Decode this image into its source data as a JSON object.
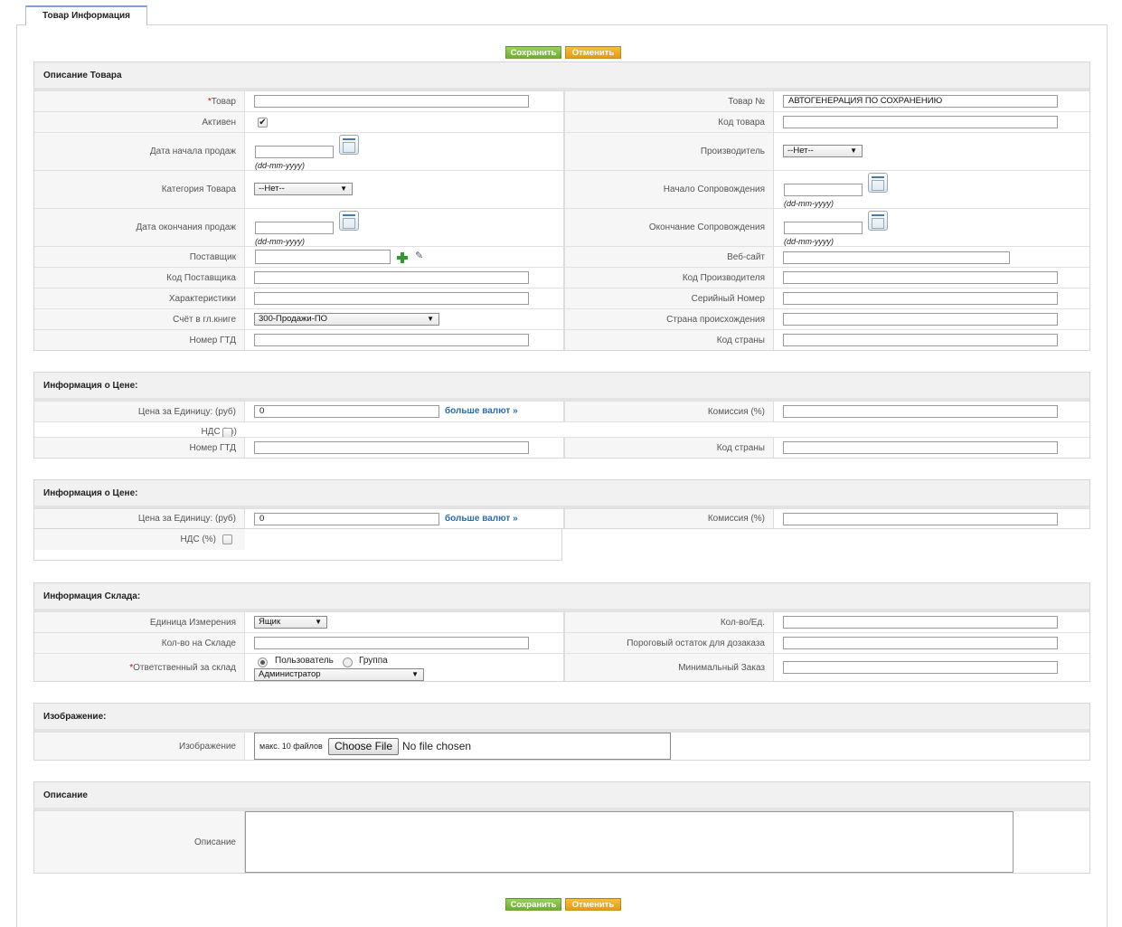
{
  "tab": {
    "label": "Товар Информация"
  },
  "buttons": {
    "save": "Сохранить",
    "cancel": "Отменить"
  },
  "sections": {
    "product": "Описание Товара",
    "price1": "Информация о Цене:",
    "price2": "Информация о Цене:",
    "stock": "Информация Склада:",
    "image": "Изображение:",
    "description": "Описание"
  },
  "product": {
    "tovar_label": "Товар",
    "tovar_no_label": "Товар №",
    "tovar_no_value": "АВТОГЕНЕРАЦИЯ ПО СОХРАНЕНИЮ",
    "active_label": "Активен",
    "active_checked": "✔",
    "code_label": "Код товара",
    "sales_start_label": "Дата начала продаж",
    "manufacturer_label": "Производитель",
    "manufacturer_value": "--Нет--",
    "category_label": "Категория Товара",
    "category_value": "--Нет--",
    "support_start_label": "Начало Сопровождения",
    "sales_end_label": "Дата окончания продаж",
    "support_end_label": "Окончание Сопровождения",
    "date_hint": "(dd-mm-yyyy)",
    "vendor_label": "Поставщик",
    "website_label": "Веб-сайт",
    "vendor_code_label": "Код Поставщика",
    "mfr_code_label": "Код Производителя",
    "specs_label": "Характеристики",
    "serial_label": "Серийный Номер",
    "gl_label": "Счёт в гл.книге",
    "gl_value": "300-Продажи-ПО",
    "origin_label": "Страна происхождения",
    "gtd_label": "Номер ГТД",
    "country_code_label": "Код страны"
  },
  "price1": {
    "unit_price_label": "Цена за Единицу: (руб)",
    "unit_price_value": "0",
    "more_currencies": "больше валют »",
    "commission_label": "Комиссия (%)",
    "vat_label": "НДС (%)",
    "gtd_label": "Номер ГТД",
    "country_code_label": "Код страны"
  },
  "price2": {
    "unit_price_label": "Цена за Единицу: (руб)",
    "unit_price_value": "0",
    "more_currencies": "больше валют »",
    "commission_label": "Комиссия (%)",
    "vat_label": "НДС (%)"
  },
  "stock": {
    "uom_label": "Единица Измерения",
    "uom_value": "Ящик",
    "qty_unit_label": "Кол-во/Ед.",
    "qty_stock_label": "Кол-во на Складе",
    "reorder_label": "Пороговый остаток для дозаказа",
    "handler_label": "Ответственный за склад",
    "radio_user": "Пользователь",
    "radio_group": "Группа",
    "handler_value": "Администратор",
    "min_order_label": "Минимальный Заказ"
  },
  "image": {
    "label": "Изображение",
    "max_files": "макс. 10 файлов",
    "choose_file": "Choose File",
    "no_file": "No file chosen"
  },
  "description": {
    "label": "Описание"
  }
}
